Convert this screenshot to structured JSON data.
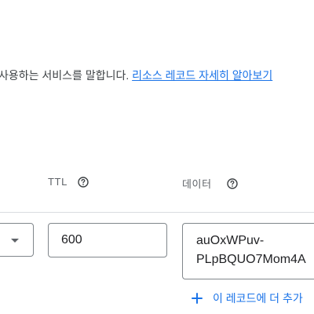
{
  "description": {
    "text": "사용하는 서비스를 말합니다. ",
    "link_label": "리소스 레코드 자세히 알아보기"
  },
  "columns": {
    "ttl_label": "TTL",
    "data_label": "데이터"
  },
  "icons": {
    "help": "help-circle-icon",
    "dropdown": "dropdown-arrow-icon",
    "add": "plus-icon"
  },
  "record": {
    "ttl_value": "600",
    "data_lines": [
      "auOxWPuv-",
      "PLpBQUO7Mom4A"
    ]
  },
  "add_item_label": "이 레코드에 더 추가",
  "colors": {
    "accent": "#1a73e8",
    "border": "#80868b",
    "divider": "#dadce0"
  }
}
